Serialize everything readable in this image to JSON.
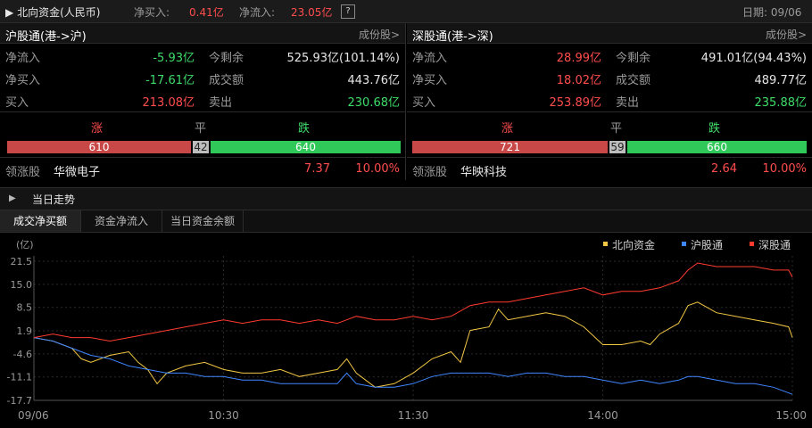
{
  "topbar": {
    "title": "北向资金(人民币)",
    "net_buy_label": "净买入:",
    "net_buy_value": "0.41亿",
    "net_flow_label": "净流入:",
    "net_flow_value": "23.05亿",
    "help": "?",
    "date_label": "日期: 09/06"
  },
  "sh": {
    "title": "沪股通(港->沪)",
    "link": "成份股>",
    "rows": [
      {
        "l1": "净流入",
        "v1": "-5.93亿",
        "l2": "今剩余",
        "v2": "525.93亿(101.14%)"
      },
      {
        "l1": "净买入",
        "v1": "-17.61亿",
        "l2": "成交额",
        "v2": "443.76亿"
      },
      {
        "l1": "买入",
        "v1": "213.08亿",
        "l2": "卖出",
        "v2": "230.68亿"
      }
    ],
    "up_label": "涨",
    "flat_label": "平",
    "down_label": "跌",
    "up": 610,
    "flat": 42,
    "down": 640,
    "up_text": "610",
    "flat_text": "42",
    "down_text": "640",
    "lead_label": "领涨股",
    "lead_name": "华微电子",
    "lead_price": "7.37",
    "lead_pct": "10.00%"
  },
  "sz": {
    "title": "深股通(港->深)",
    "link": "成份股>",
    "rows": [
      {
        "l1": "净流入",
        "v1": "28.99亿",
        "l2": "今剩余",
        "v2": "491.01亿(94.43%)"
      },
      {
        "l1": "净买入",
        "v1": "18.02亿",
        "l2": "成交额",
        "v2": "489.77亿"
      },
      {
        "l1": "买入",
        "v1": "253.89亿",
        "l2": "卖出",
        "v2": "235.88亿"
      }
    ],
    "up_label": "涨",
    "flat_label": "平",
    "down_label": "跌",
    "up": 721,
    "flat": 59,
    "down": 660,
    "up_text": "721",
    "flat_text": "59",
    "down_text": "660",
    "lead_label": "领涨股",
    "lead_name": "华映科技",
    "lead_price": "2.64",
    "lead_pct": "10.00%"
  },
  "trend": {
    "title": "当日走势"
  },
  "tabs": [
    "成交净买额",
    "资金净流入",
    "当日资金余额"
  ],
  "colors": {
    "red": "#ff4d4d",
    "green": "#3fdc6a",
    "north": "#f2c744",
    "sh": "#3f86ff",
    "sz": "#ff3b30"
  },
  "chart_data": {
    "type": "line",
    "unit_label": "(亿)",
    "yticks": [
      21.5,
      15.0,
      8.5,
      1.9,
      -4.6,
      -11.1,
      -17.7
    ],
    "ytick_labels": [
      "21.5",
      "15.0",
      "8.5",
      "1.9",
      "-4.6",
      "-11.1",
      "-17.7"
    ],
    "xticks": [
      "09/06",
      "10:30",
      "11:30",
      "14:00",
      "15:00"
    ],
    "ylim": [
      -17.7,
      21.5
    ],
    "xlim": [
      0,
      240
    ],
    "legend_position": "top-right",
    "series": [
      {
        "name": "北向资金",
        "color": "#f2c744",
        "points": [
          [
            0,
            0
          ],
          [
            10,
            -1
          ],
          [
            20,
            -3
          ],
          [
            25,
            -6
          ],
          [
            30,
            -7
          ],
          [
            40,
            -5
          ],
          [
            50,
            -4
          ],
          [
            55,
            -7
          ],
          [
            60,
            -9
          ],
          [
            65,
            -13
          ],
          [
            70,
            -10
          ],
          [
            80,
            -8
          ],
          [
            90,
            -7
          ],
          [
            100,
            -9
          ],
          [
            110,
            -10
          ],
          [
            120,
            -10
          ],
          [
            130,
            -9
          ],
          [
            140,
            -11
          ],
          [
            150,
            -10
          ],
          [
            160,
            -9
          ],
          [
            165,
            -6
          ],
          [
            170,
            -10
          ],
          [
            180,
            -14
          ],
          [
            190,
            -13
          ],
          [
            200,
            -10
          ],
          [
            210,
            -6
          ],
          [
            220,
            -4
          ],
          [
            225,
            -7
          ],
          [
            230,
            2
          ],
          [
            240,
            3
          ],
          [
            245,
            8
          ],
          [
            250,
            5
          ],
          [
            260,
            6
          ],
          [
            270,
            7
          ],
          [
            280,
            6
          ],
          [
            290,
            3
          ],
          [
            300,
            -2
          ],
          [
            310,
            -2
          ],
          [
            320,
            -1
          ],
          [
            325,
            -2
          ],
          [
            330,
            1
          ],
          [
            340,
            4
          ],
          [
            345,
            9
          ],
          [
            350,
            10
          ],
          [
            360,
            7
          ],
          [
            370,
            6
          ],
          [
            380,
            5
          ],
          [
            390,
            4
          ],
          [
            398,
            3
          ],
          [
            400,
            0
          ]
        ]
      },
      {
        "name": "沪股通",
        "color": "#3f86ff",
        "points": [
          [
            0,
            0
          ],
          [
            10,
            -1
          ],
          [
            20,
            -3
          ],
          [
            30,
            -5
          ],
          [
            40,
            -6
          ],
          [
            50,
            -8
          ],
          [
            60,
            -9
          ],
          [
            70,
            -10
          ],
          [
            80,
            -10
          ],
          [
            90,
            -11
          ],
          [
            100,
            -11
          ],
          [
            110,
            -12
          ],
          [
            120,
            -12
          ],
          [
            130,
            -13
          ],
          [
            140,
            -13
          ],
          [
            150,
            -13
          ],
          [
            160,
            -13
          ],
          [
            165,
            -10
          ],
          [
            170,
            -13
          ],
          [
            180,
            -14
          ],
          [
            190,
            -14
          ],
          [
            200,
            -13
          ],
          [
            210,
            -11
          ],
          [
            220,
            -10
          ],
          [
            230,
            -10
          ],
          [
            240,
            -10
          ],
          [
            250,
            -11
          ],
          [
            260,
            -10
          ],
          [
            270,
            -10
          ],
          [
            280,
            -11
          ],
          [
            290,
            -11
          ],
          [
            300,
            -12
          ],
          [
            310,
            -13
          ],
          [
            320,
            -12
          ],
          [
            330,
            -13
          ],
          [
            340,
            -12
          ],
          [
            345,
            -11
          ],
          [
            350,
            -11
          ],
          [
            360,
            -12
          ],
          [
            370,
            -13
          ],
          [
            380,
            -13
          ],
          [
            390,
            -14
          ],
          [
            400,
            -16
          ]
        ]
      },
      {
        "name": "深股通",
        "color": "#ff3b30",
        "points": [
          [
            0,
            0
          ],
          [
            10,
            1
          ],
          [
            20,
            0
          ],
          [
            30,
            0
          ],
          [
            40,
            -1
          ],
          [
            50,
            0
          ],
          [
            60,
            1
          ],
          [
            70,
            2
          ],
          [
            80,
            3
          ],
          [
            90,
            4
          ],
          [
            100,
            5
          ],
          [
            110,
            4
          ],
          [
            120,
            5
          ],
          [
            130,
            5
          ],
          [
            140,
            4
          ],
          [
            150,
            5
          ],
          [
            160,
            4
          ],
          [
            170,
            6
          ],
          [
            180,
            5
          ],
          [
            190,
            5
          ],
          [
            200,
            6
          ],
          [
            210,
            5
          ],
          [
            220,
            6
          ],
          [
            230,
            9
          ],
          [
            240,
            10
          ],
          [
            250,
            10
          ],
          [
            260,
            11
          ],
          [
            270,
            12
          ],
          [
            280,
            13
          ],
          [
            290,
            14
          ],
          [
            300,
            12
          ],
          [
            310,
            13
          ],
          [
            320,
            13
          ],
          [
            330,
            14
          ],
          [
            340,
            16
          ],
          [
            345,
            19
          ],
          [
            350,
            21
          ],
          [
            360,
            20
          ],
          [
            370,
            20
          ],
          [
            380,
            20
          ],
          [
            390,
            19
          ],
          [
            398,
            19
          ],
          [
            400,
            17
          ]
        ]
      }
    ]
  }
}
